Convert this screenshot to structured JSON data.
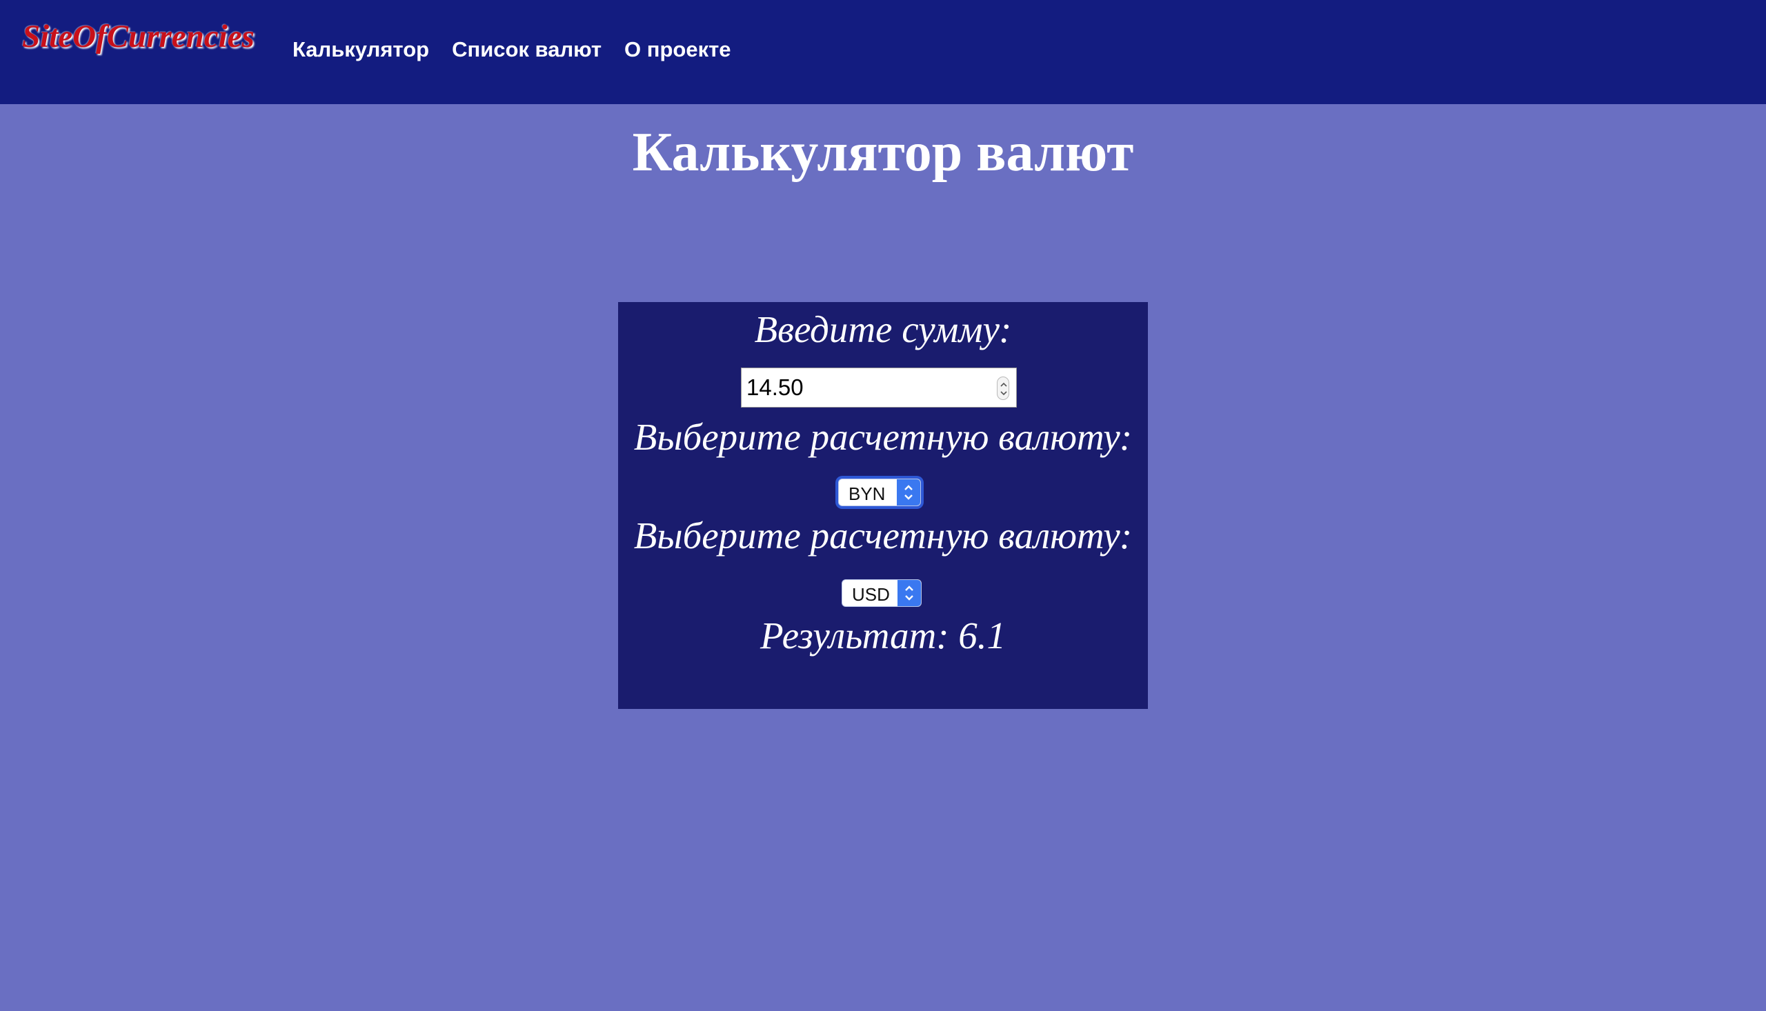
{
  "header": {
    "logo": "SiteOfCurrencies",
    "nav": [
      {
        "label": "Калькулятор"
      },
      {
        "label": "Список валют"
      },
      {
        "label": "О проекте"
      }
    ]
  },
  "main": {
    "title": "Калькулятор валют"
  },
  "calculator": {
    "amount_label": "Введите сумму:",
    "amount_value": "14.50",
    "from_label": "Выберите расчетную валюту:",
    "from_currency": "BYN",
    "to_label": "Выберите расчетную валюту:",
    "to_currency": "USD",
    "result_text": "Результат: 6.1"
  },
  "colors": {
    "header_bg": "#131c80",
    "page_bg": "#6a6fc2",
    "panel_bg": "#1a1c6e",
    "logo": "#c8101a",
    "select_accent": "#3a78f0"
  },
  "icons": {
    "spinner": "up-down-stepper-icon",
    "select_arrow": "chevron-up-down-icon"
  }
}
